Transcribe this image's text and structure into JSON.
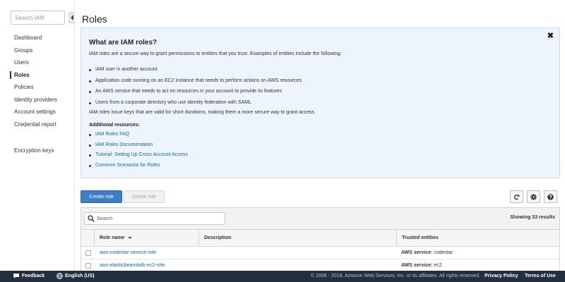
{
  "sidebar": {
    "search_placeholder": "Search IAM",
    "items": [
      {
        "label": "Dashboard"
      },
      {
        "label": "Groups"
      },
      {
        "label": "Users"
      },
      {
        "label": "Roles"
      },
      {
        "label": "Policies"
      },
      {
        "label": "Identity providers"
      },
      {
        "label": "Account settings"
      },
      {
        "label": "Credential report"
      }
    ],
    "secondary_items": [
      {
        "label": "Encryption keys"
      }
    ],
    "active": "Roles"
  },
  "page": {
    "title": "Roles"
  },
  "info_panel": {
    "close_glyph": "✖",
    "title": "What are IAM roles?",
    "intro": "IAM roles are a secure way to grant permissions to entities that you trust. Examples of entities include the following:",
    "bullets": [
      "IAM user in another account",
      "Application code running on an EC2 instance that needs to perform actions on AWS resources",
      "An AWS service that needs to act on resources in your account to provide its features",
      "Users from a corporate directory who use identity federation with SAML"
    ],
    "keys_note": "IAM roles issue keys that are valid for short durations, making them a more secure way to grant access.",
    "resources_heading": "Additional resources:",
    "links": [
      "IAM Roles FAQ",
      "IAM Roles Documentation",
      "Tutorial: Setting Up Cross Account Access",
      "Common Scenarios for Roles"
    ]
  },
  "toolbar": {
    "create_label": "Create role",
    "delete_label": "Delete role",
    "icons": [
      "refresh-icon",
      "gear-icon",
      "help-icon"
    ]
  },
  "table": {
    "search_placeholder": "Search",
    "results_text": "Showing 33 results",
    "columns": [
      "Role name",
      "Description",
      "Trusted entities"
    ],
    "rows": [
      {
        "name": "aws-codestar-service-role",
        "description": "",
        "trusted_prefix": "AWS service:",
        "trusted_value": "codestar"
      },
      {
        "name": "aws-elasticbeanstalk-ec2-role",
        "description": "",
        "trusted_prefix": "AWS service:",
        "trusted_value": "ec2"
      }
    ]
  },
  "footer": {
    "feedback": "Feedback",
    "language": "English (US)",
    "copyright": "© 2008 - 2018, Amazon Web Services, Inc. or its affiliates. All rights reserved.",
    "privacy": "Privacy Policy",
    "terms": "Terms of Use"
  },
  "colors": {
    "primary_button": "#3d7cc7",
    "link": "#1066bb",
    "info_panel_bg": "#eef4fb",
    "footer_bg": "#232f3e"
  }
}
